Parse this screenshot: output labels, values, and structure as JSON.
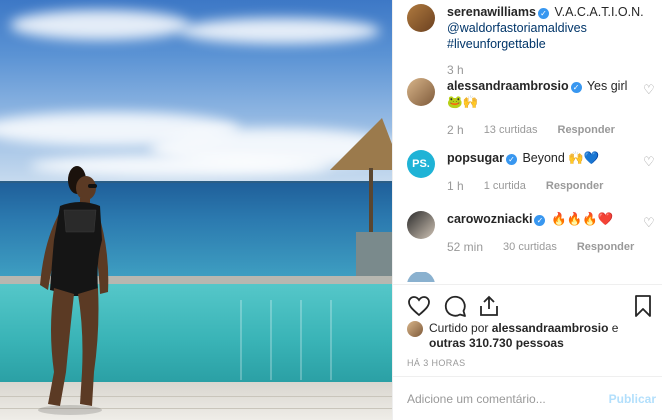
{
  "post": {
    "author": "serenawilliams",
    "caption_line1": "V.A.C.A.T.I.O.N.",
    "caption_mention": "@waldorfastoriamaldives",
    "caption_hashtag": "#liveunforgettable",
    "time": "3 h"
  },
  "comments": [
    {
      "user": "alessandraambrosio",
      "text": "Yes girl",
      "emoji": "🐸🙌",
      "time": "2 h",
      "likes": "13 curtidas",
      "reply": "Responder",
      "avatar": "alessandra"
    },
    {
      "user": "popsugar",
      "text": "Beyond",
      "emoji": "🙌💙",
      "time": "1 h",
      "likes": "1 curtida",
      "reply": "Responder",
      "avatar_text": "PS."
    },
    {
      "user": "carowozniacki",
      "text": "",
      "emoji": "🔥🔥🔥❤️",
      "time": "52 min",
      "likes": "30 curtidas",
      "reply": "Responder",
      "avatar": "caro"
    }
  ],
  "likes": {
    "prefix": "Curtido por",
    "user": "alessandraambrosio",
    "connector": "e",
    "others": "outras 310.730 pessoas"
  },
  "timestamp": "HÁ 3 HORAS",
  "comment_input": {
    "placeholder": "Adicione um comentário...",
    "submit": "Publicar"
  },
  "icons": {
    "like": "heart-icon",
    "comment": "comment-icon",
    "share": "share-icon",
    "save": "bookmark-icon"
  },
  "colors": {
    "verified": "#3897f0",
    "link": "#003569",
    "popsugar": "#1fb3d6",
    "publish_disabled": "#b2dffc"
  }
}
